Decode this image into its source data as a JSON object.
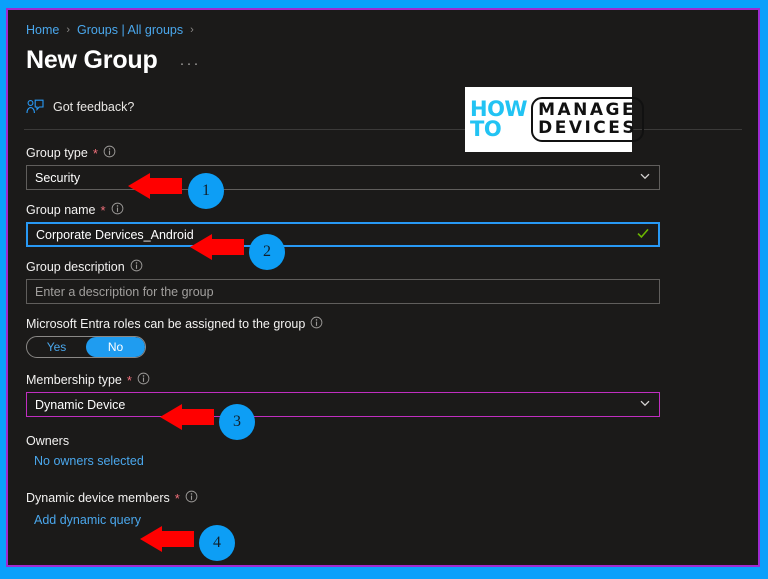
{
  "window": {
    "border_color": "#0aa0fb",
    "inner_border_color": "#a02ad0",
    "background": "#1b1a19"
  },
  "breadcrumb": {
    "items": [
      {
        "label": "Home"
      },
      {
        "label": "Groups | All groups"
      }
    ],
    "separator": "›"
  },
  "header": {
    "title": "New Group",
    "more_button": "···"
  },
  "feedback": {
    "label": "Got feedback?",
    "icon": "feedback-person-icon"
  },
  "logo": {
    "how": "HOW",
    "to": "TO",
    "manage": "MANAGE",
    "devices": "DEVICES",
    "accent_color": "#22c3f3"
  },
  "form": {
    "group_type": {
      "label": "Group type",
      "required": "*",
      "value": "Security",
      "chevron": "chevron-down-icon"
    },
    "group_name": {
      "label": "Group name",
      "required": "*",
      "value": "Corporate Dervices_Android",
      "validation": "valid",
      "border_color": "#2899f5"
    },
    "group_description": {
      "label": "Group description",
      "placeholder": "Enter a description for the group",
      "value": ""
    },
    "entra_roles": {
      "label": "Microsoft Entra roles can be assigned to the group",
      "options": [
        "Yes",
        "No"
      ],
      "selected": "No"
    },
    "membership_type": {
      "label": "Membership type",
      "required": "*",
      "value": "Dynamic Device",
      "chevron": "chevron-down-icon",
      "border_color": "#c02ec0"
    },
    "owners": {
      "label": "Owners",
      "link": "No owners selected"
    },
    "dynamic_members": {
      "label": "Dynamic device members",
      "required": "*",
      "link": "Add dynamic query"
    }
  },
  "annotations": {
    "color": "#0d9ef5",
    "arrow_color": "#ff0000",
    "markers": [
      {
        "number": "1",
        "target": "group-type-dropdown"
      },
      {
        "number": "2",
        "target": "group-name-input"
      },
      {
        "number": "3",
        "target": "membership-type-dropdown"
      },
      {
        "number": "4",
        "target": "add-dynamic-query-link"
      }
    ]
  }
}
